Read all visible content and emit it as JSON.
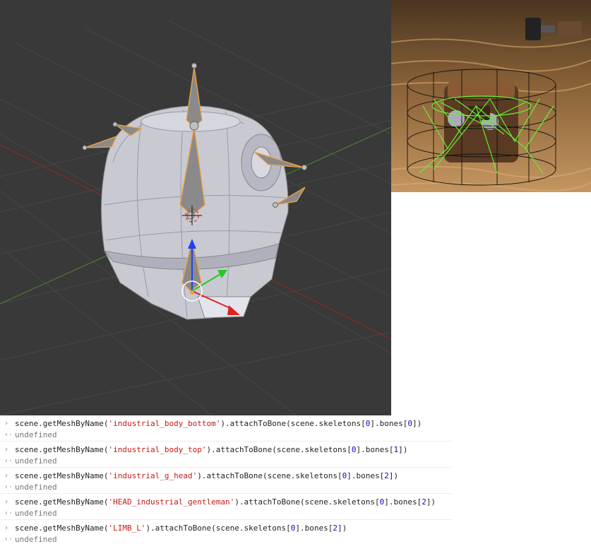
{
  "viewport": {
    "background": "#393939",
    "axis_x_color": "#8b2a2a",
    "axis_y_color": "#5a8a3a",
    "mesh_color": "#c8c8d0",
    "bone_outline_color": "#f0a040"
  },
  "preview": {
    "sand_color": "#b88850",
    "wire_dark_color": "#111111",
    "wire_green_color": "#66ee33"
  },
  "console": {
    "prompt_icon": "›",
    "result_icon": "‹·",
    "entries": [
      {
        "prefix": "scene.getMeshByName(",
        "mesh": "'industrial_body_bottom'",
        "mid": ").attachToBone(scene.skeletons[",
        "skel": "0",
        "mid2": "].bones[",
        "bone": "0",
        "suffix": "])",
        "result": "undefined"
      },
      {
        "prefix": "scene.getMeshByName(",
        "mesh": "'industrial_body_top'",
        "mid": ").attachToBone(scene.skeletons[",
        "skel": "0",
        "mid2": "].bones[",
        "bone": "1",
        "suffix": "])",
        "result": "undefined"
      },
      {
        "prefix": "scene.getMeshByName(",
        "mesh": "'industrial_g_head'",
        "mid": ").attachToBone(scene.skeletons[",
        "skel": "0",
        "mid2": "].bones[",
        "bone": "2",
        "suffix": "])",
        "result": "undefined"
      },
      {
        "prefix": "scene.getMeshByName(",
        "mesh": "'HEAD_industrial_gentleman'",
        "mid": ").attachToBone(scene.skeletons[",
        "skel": "0",
        "mid2": "].bones[",
        "bone": "2",
        "suffix": "])",
        "result": "undefined"
      },
      {
        "prefix": "scene.getMeshByName(",
        "mesh": "'LIMB_L'",
        "mid": ").attachToBone(scene.skeletons[",
        "skel": "0",
        "mid2": "].bones[",
        "bone": "2",
        "suffix": "])",
        "result": "undefined"
      }
    ]
  }
}
